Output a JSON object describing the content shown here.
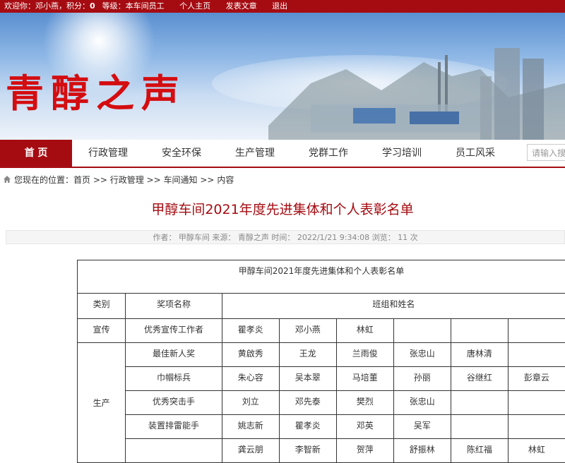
{
  "topbar": {
    "welcome": "欢迎你：邓小燕，积分：",
    "points": "0",
    "level_label": "等级：本车间员工",
    "links": [
      "个人主页",
      "发表文章",
      "退出"
    ]
  },
  "banner": {
    "title": "青醇之声"
  },
  "nav": {
    "items": [
      "首 页",
      "行政管理",
      "安全环保",
      "生产管理",
      "党群工作",
      "学习培训",
      "员工风采"
    ],
    "search_placeholder": "请输入搜"
  },
  "breadcrumb": {
    "prefix": "您现在的位置：",
    "items": [
      "首页",
      "行政管理",
      "车间通知",
      "内容"
    ],
    "sep": " >> "
  },
  "article": {
    "title": "甲醇车间2021年度先进集体和个人表彰名单",
    "meta": "作者：  甲醇车间    来源：  青醇之声  时间：  2022/1/21 9:34:08  浏览：  11 次"
  },
  "table": {
    "caption": "甲醇车间2021年度先进集体和个人表彰名单",
    "headers": [
      "类别",
      "奖项名称",
      "班组和姓名"
    ],
    "categories": [
      "宣传",
      "生产"
    ],
    "rows": [
      {
        "award": "优秀宣传工作者",
        "names": [
          "瞿孝炎",
          "邓小燕",
          "林虹",
          "",
          "",
          ""
        ]
      },
      {
        "award": "最佳新人奖",
        "names": [
          "黄啟秀",
          "王龙",
          "兰雨俊",
          "张忠山",
          "唐林清",
          ""
        ]
      },
      {
        "award": "巾帼标兵",
        "names": [
          "朱心容",
          "吴本翠",
          "马培董",
          "孙丽",
          "谷继红",
          "彭章云"
        ]
      },
      {
        "award": "优秀突击手",
        "names": [
          "刘立",
          "邓先泰",
          "樊烈",
          "张忠山",
          "",
          ""
        ]
      },
      {
        "award": "装置排雷能手",
        "names": [
          "姚志新",
          "瞿孝炎",
          "邓英",
          "吴军",
          "",
          ""
        ]
      },
      {
        "award": "",
        "names": [
          "龚云朋",
          "李智新",
          "贺萍",
          "舒振林",
          "陈红福",
          "林虹"
        ]
      }
    ]
  }
}
